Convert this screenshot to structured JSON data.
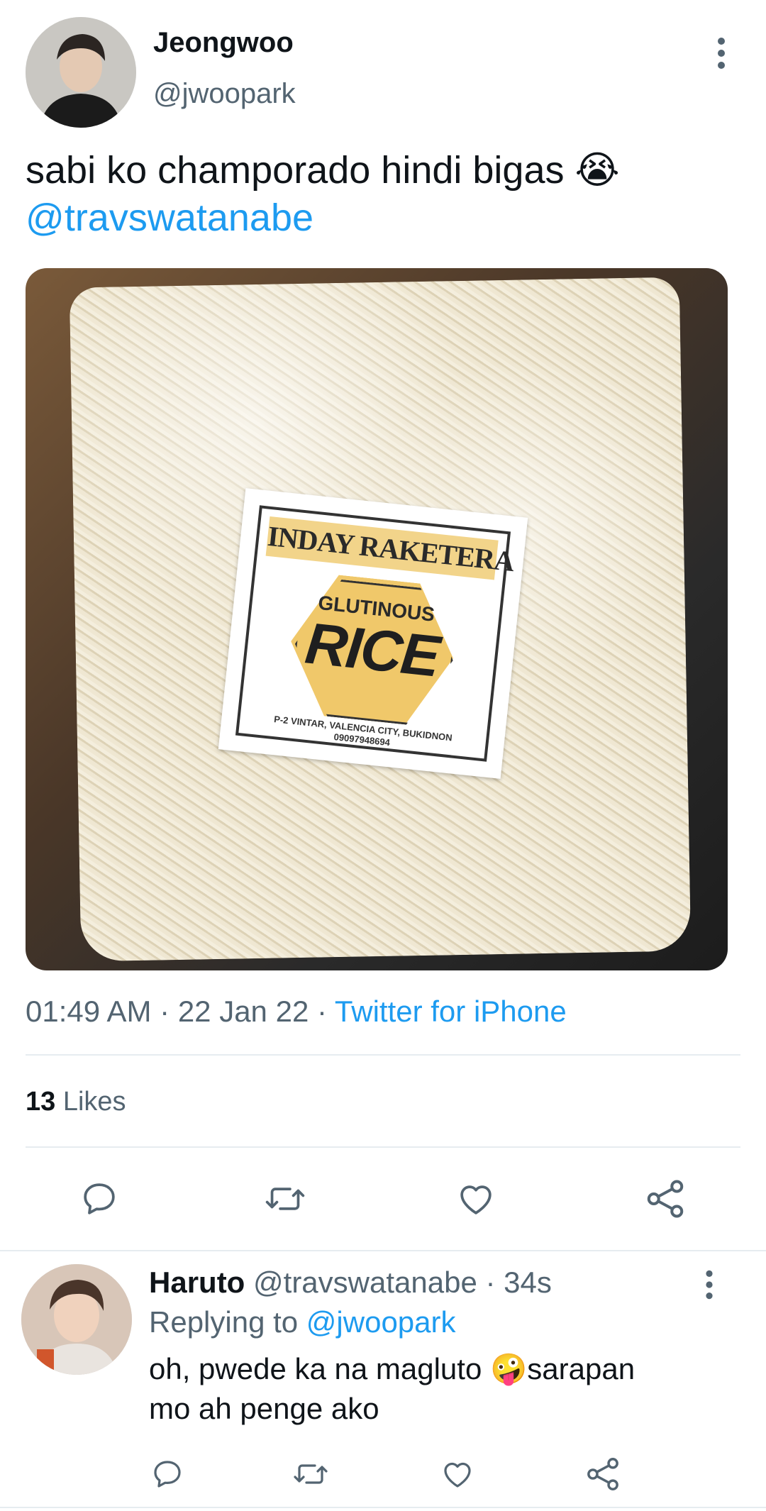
{
  "tweet": {
    "display_name": "Jeongwoo",
    "handle": "@jwoopark",
    "text": "sabi ko champorado hindi bigas 😭",
    "mention": "@travswatanabe",
    "time": "01:49 AM",
    "date": "22 Jan 22",
    "separator": "·",
    "source": "Twitter for iPhone",
    "likes_count": "13",
    "likes_label": "Likes",
    "image": {
      "brand": "INDAY RAKETERA",
      "product_top": "GLUTINOUS",
      "product_main": "RICE",
      "address": "P-2 VINTAR, VALENCIA CITY, BUKIDNON",
      "phone": "09097948694"
    }
  },
  "reply": {
    "display_name": "Haruto",
    "handle": "@travswatanabe",
    "time": "· 34s",
    "replying_prefix": "Replying to",
    "replying_to": "@jwoopark",
    "text_line1": "oh, pwede ka na magluto 🤪sarapan",
    "text_line2": "mo ah penge ako"
  },
  "icons": [
    "more-vertical-icon",
    "reply-icon",
    "retweet-icon",
    "like-icon",
    "share-icon"
  ],
  "colors": {
    "link": "#1d9bf0",
    "muted": "#536471",
    "text": "#0f1419",
    "divider": "#e6ecf0"
  }
}
